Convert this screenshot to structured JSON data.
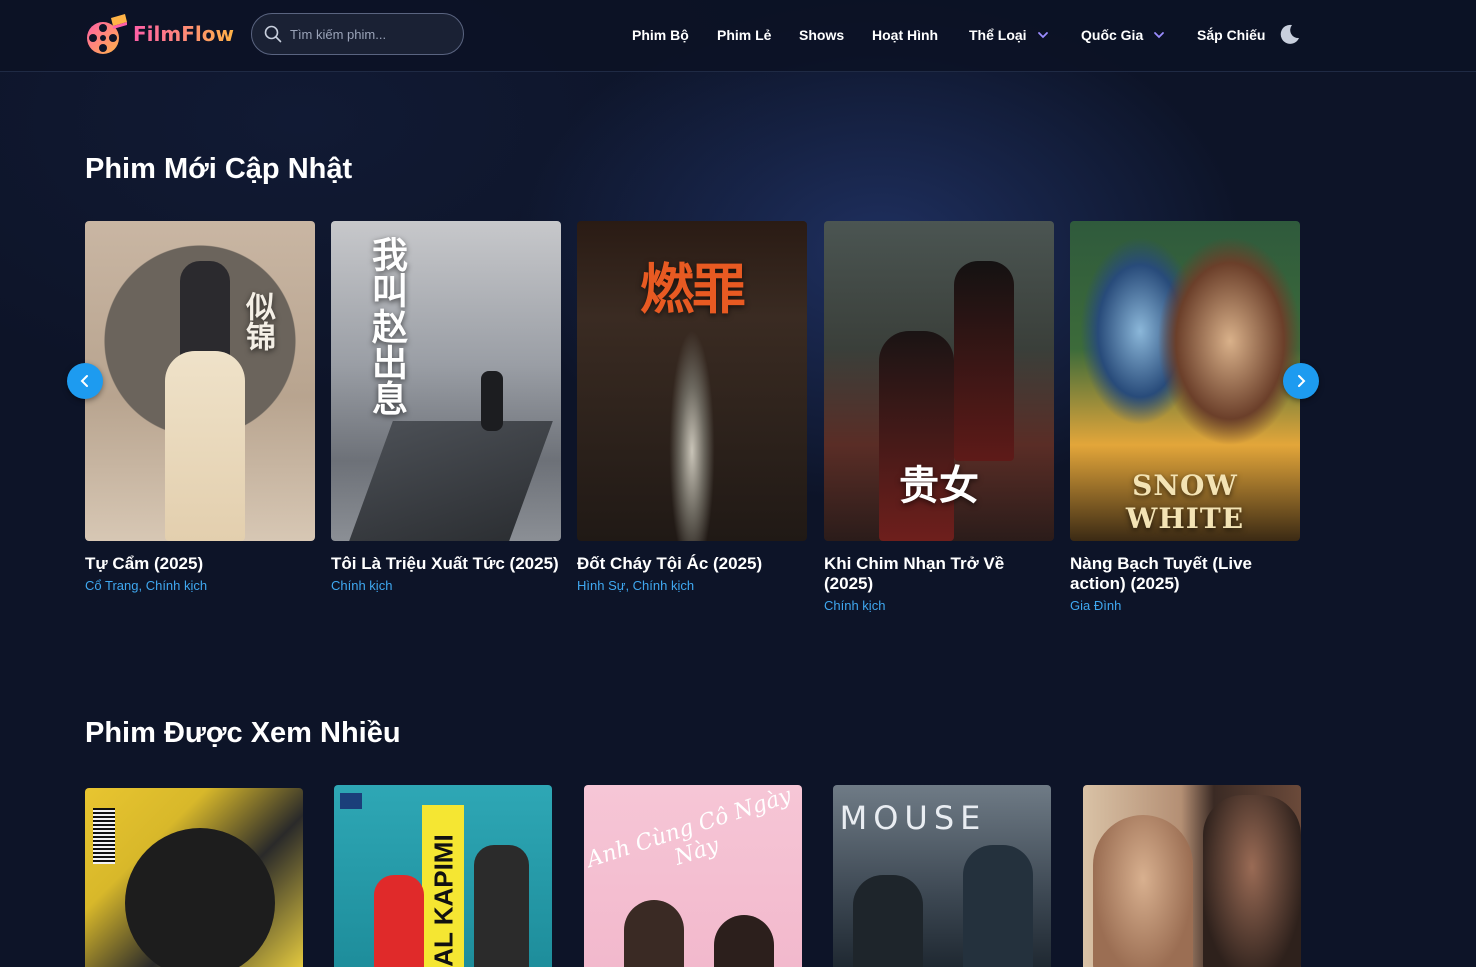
{
  "brand": {
    "name": "FilmFlow"
  },
  "search": {
    "placeholder": "Tìm kiếm phim..."
  },
  "nav": {
    "items": [
      {
        "label": "Phim Bộ"
      },
      {
        "label": "Phim Lẻ"
      },
      {
        "label": "Shows"
      },
      {
        "label": "Hoạt Hình"
      },
      {
        "label": "Thể Loại"
      },
      {
        "label": "Quốc Gia"
      },
      {
        "label": "Sắp Chiếu"
      }
    ],
    "theme_icon": "moon-icon"
  },
  "sections": {
    "new": {
      "title": "Phim Mới Cập Nhật",
      "movies": [
        {
          "title": "Tự Cẩm (2025)",
          "genres": "Cổ Trang, Chính kịch",
          "poster_text": "似锦"
        },
        {
          "title": "Tôi Là Triệu Xuất Tức (2025)",
          "genres": "Chính kịch",
          "poster_text": "我叫赵出息"
        },
        {
          "title": "Đốt Cháy Tội Ác (2025)",
          "genres": "Hình Sự, Chính kịch",
          "poster_text": "燃罪"
        },
        {
          "title": "Khi Chim Nhạn Trở Về (2025)",
          "genres": "Chính kịch",
          "poster_text": "贵女"
        },
        {
          "title": "Nàng Bạch Tuyết (Live action) (2025)",
          "genres": "Gia Đình",
          "poster_text": "SNOW WHITE"
        }
      ]
    },
    "popular": {
      "title": "Phim Được Xem Nhiều",
      "movies": [
        {
          "poster_text": ""
        },
        {
          "poster_text": "AL KAPIMI"
        },
        {
          "poster_text": "Anh Cùng Cô Ngày Này"
        },
        {
          "poster_text": "MOUSE"
        },
        {
          "poster_text": ""
        }
      ]
    }
  },
  "colors": {
    "background": "#0d1428",
    "accent": "#1d9bf0",
    "genre_link": "#3fa8f0"
  }
}
